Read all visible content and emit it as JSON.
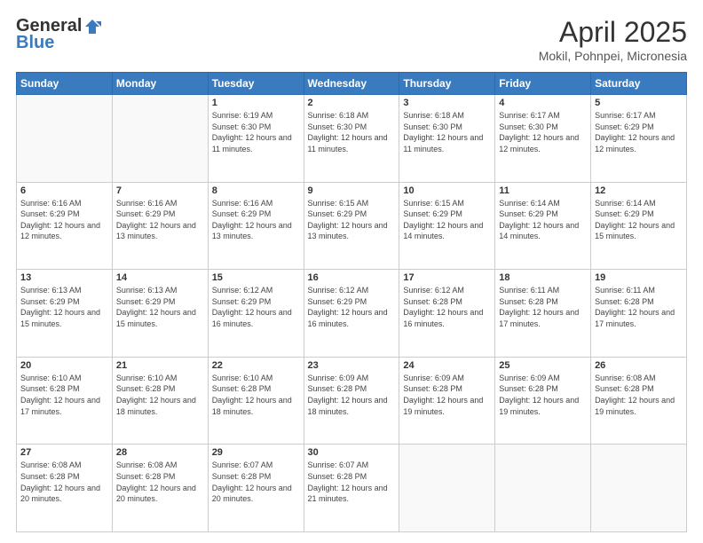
{
  "header": {
    "logo_general": "General",
    "logo_blue": "Blue",
    "title": "April 2025",
    "location": "Mokil, Pohnpei, Micronesia"
  },
  "days_of_week": [
    "Sunday",
    "Monday",
    "Tuesday",
    "Wednesday",
    "Thursday",
    "Friday",
    "Saturday"
  ],
  "weeks": [
    [
      {
        "day": "",
        "info": ""
      },
      {
        "day": "",
        "info": ""
      },
      {
        "day": "1",
        "info": "Sunrise: 6:19 AM\nSunset: 6:30 PM\nDaylight: 12 hours and 11 minutes."
      },
      {
        "day": "2",
        "info": "Sunrise: 6:18 AM\nSunset: 6:30 PM\nDaylight: 12 hours and 11 minutes."
      },
      {
        "day": "3",
        "info": "Sunrise: 6:18 AM\nSunset: 6:30 PM\nDaylight: 12 hours and 11 minutes."
      },
      {
        "day": "4",
        "info": "Sunrise: 6:17 AM\nSunset: 6:30 PM\nDaylight: 12 hours and 12 minutes."
      },
      {
        "day": "5",
        "info": "Sunrise: 6:17 AM\nSunset: 6:29 PM\nDaylight: 12 hours and 12 minutes."
      }
    ],
    [
      {
        "day": "6",
        "info": "Sunrise: 6:16 AM\nSunset: 6:29 PM\nDaylight: 12 hours and 12 minutes."
      },
      {
        "day": "7",
        "info": "Sunrise: 6:16 AM\nSunset: 6:29 PM\nDaylight: 12 hours and 13 minutes."
      },
      {
        "day": "8",
        "info": "Sunrise: 6:16 AM\nSunset: 6:29 PM\nDaylight: 12 hours and 13 minutes."
      },
      {
        "day": "9",
        "info": "Sunrise: 6:15 AM\nSunset: 6:29 PM\nDaylight: 12 hours and 13 minutes."
      },
      {
        "day": "10",
        "info": "Sunrise: 6:15 AM\nSunset: 6:29 PM\nDaylight: 12 hours and 14 minutes."
      },
      {
        "day": "11",
        "info": "Sunrise: 6:14 AM\nSunset: 6:29 PM\nDaylight: 12 hours and 14 minutes."
      },
      {
        "day": "12",
        "info": "Sunrise: 6:14 AM\nSunset: 6:29 PM\nDaylight: 12 hours and 15 minutes."
      }
    ],
    [
      {
        "day": "13",
        "info": "Sunrise: 6:13 AM\nSunset: 6:29 PM\nDaylight: 12 hours and 15 minutes."
      },
      {
        "day": "14",
        "info": "Sunrise: 6:13 AM\nSunset: 6:29 PM\nDaylight: 12 hours and 15 minutes."
      },
      {
        "day": "15",
        "info": "Sunrise: 6:12 AM\nSunset: 6:29 PM\nDaylight: 12 hours and 16 minutes."
      },
      {
        "day": "16",
        "info": "Sunrise: 6:12 AM\nSunset: 6:29 PM\nDaylight: 12 hours and 16 minutes."
      },
      {
        "day": "17",
        "info": "Sunrise: 6:12 AM\nSunset: 6:28 PM\nDaylight: 12 hours and 16 minutes."
      },
      {
        "day": "18",
        "info": "Sunrise: 6:11 AM\nSunset: 6:28 PM\nDaylight: 12 hours and 17 minutes."
      },
      {
        "day": "19",
        "info": "Sunrise: 6:11 AM\nSunset: 6:28 PM\nDaylight: 12 hours and 17 minutes."
      }
    ],
    [
      {
        "day": "20",
        "info": "Sunrise: 6:10 AM\nSunset: 6:28 PM\nDaylight: 12 hours and 17 minutes."
      },
      {
        "day": "21",
        "info": "Sunrise: 6:10 AM\nSunset: 6:28 PM\nDaylight: 12 hours and 18 minutes."
      },
      {
        "day": "22",
        "info": "Sunrise: 6:10 AM\nSunset: 6:28 PM\nDaylight: 12 hours and 18 minutes."
      },
      {
        "day": "23",
        "info": "Sunrise: 6:09 AM\nSunset: 6:28 PM\nDaylight: 12 hours and 18 minutes."
      },
      {
        "day": "24",
        "info": "Sunrise: 6:09 AM\nSunset: 6:28 PM\nDaylight: 12 hours and 19 minutes."
      },
      {
        "day": "25",
        "info": "Sunrise: 6:09 AM\nSunset: 6:28 PM\nDaylight: 12 hours and 19 minutes."
      },
      {
        "day": "26",
        "info": "Sunrise: 6:08 AM\nSunset: 6:28 PM\nDaylight: 12 hours and 19 minutes."
      }
    ],
    [
      {
        "day": "27",
        "info": "Sunrise: 6:08 AM\nSunset: 6:28 PM\nDaylight: 12 hours and 20 minutes."
      },
      {
        "day": "28",
        "info": "Sunrise: 6:08 AM\nSunset: 6:28 PM\nDaylight: 12 hours and 20 minutes."
      },
      {
        "day": "29",
        "info": "Sunrise: 6:07 AM\nSunset: 6:28 PM\nDaylight: 12 hours and 20 minutes."
      },
      {
        "day": "30",
        "info": "Sunrise: 6:07 AM\nSunset: 6:28 PM\nDaylight: 12 hours and 21 minutes."
      },
      {
        "day": "",
        "info": ""
      },
      {
        "day": "",
        "info": ""
      },
      {
        "day": "",
        "info": ""
      }
    ]
  ]
}
